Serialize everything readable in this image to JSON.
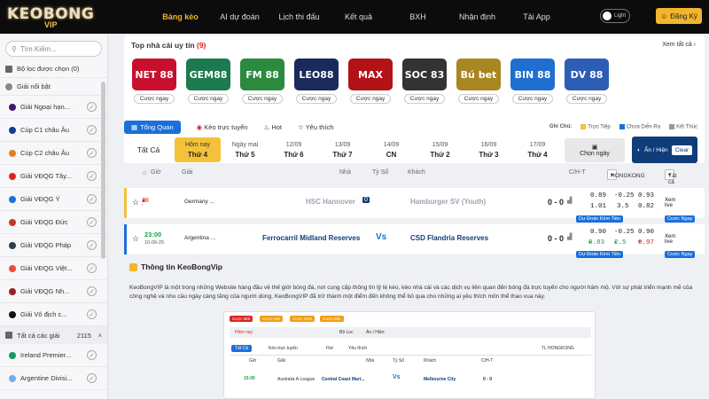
{
  "header": {
    "logo_top": "KEOBONG",
    "logo_bottom": "VIP",
    "nav": [
      "Bảng kèo",
      "AI dự đoán",
      "Lịch thi đấu",
      "Kết quả",
      "BXH",
      "Nhận định",
      "Tải App"
    ],
    "theme": "Light",
    "register": "Đăng Ký"
  },
  "sidebar": {
    "search_placeholder": "Tìm Kiếm...",
    "filter_label": "Bộ lọc được chọn (0)",
    "featured": "Giải nổi bật",
    "leagues": [
      "Giải Ngoại hạn...",
      "Cúp C1 châu Âu",
      "Cúp C2 châu Âu",
      "Giải VĐQG Tây...",
      "Giải VĐQG Ý",
      "Giải VĐQG Đức",
      "Giải VĐQG Pháp",
      "Giải VĐQG Việt...",
      "Giải VĐQG Nh...",
      "Giải Vô địch c..."
    ],
    "all_label": "Tất cả các giải",
    "all_count": "2115",
    "extra": [
      "Ireland Premier...",
      "Argentine Divisi..."
    ]
  },
  "top": {
    "title": "Top nhà cái uy tín",
    "count": "(9)",
    "see_all": "Xem tất cả",
    "bet": "Cược ngay",
    "books": [
      {
        "name": "NET 88",
        "bg": "#c8102e"
      },
      {
        "name": "GEM88",
        "bg": "#1c7a4e"
      },
      {
        "name": "FM 88",
        "bg": "#2b8a3e"
      },
      {
        "name": "LEO88",
        "bg": "#1a2a5a"
      },
      {
        "name": "MAX",
        "bg": "#b31217"
      },
      {
        "name": "SOC 83",
        "bg": "#333"
      },
      {
        "name": "Bú bet",
        "bg": "#a88620"
      },
      {
        "name": "BIN 88",
        "bg": "#1f6fd1"
      },
      {
        "name": "DV 88",
        "bg": "#2d5db5"
      }
    ]
  },
  "filters": {
    "overview": "Tổng Quan",
    "live": "Kèo trực tuyến",
    "hot": "Hot",
    "fav": "Yêu thích",
    "note": "Ghi Chú:",
    "legend": [
      "Trực Tiếp",
      "Chưa Diễn Ra",
      "Kết Thúc"
    ]
  },
  "days": [
    {
      "l1": "Tất Cả",
      "l2": ""
    },
    {
      "l1": "Hôm nay",
      "l2": "Thứ 4"
    },
    {
      "l1": "Ngày mai",
      "l2": "Thứ 5"
    },
    {
      "l1": "12/09",
      "l2": "Thứ 6"
    },
    {
      "l1": "13/09",
      "l2": "Thứ 7"
    },
    {
      "l1": "14/09",
      "l2": "CN"
    },
    {
      "l1": "15/09",
      "l2": "Thứ 2"
    },
    {
      "l1": "16/09",
      "l2": "Thứ 3"
    },
    {
      "l1": "17/09",
      "l2": "Thứ 4"
    }
  ],
  "choose_date": "Chọn ngày",
  "show_hide": "Ẩn / Hiện",
  "clear": "Clear",
  "table": {
    "time": "Giờ",
    "league": "Giải",
    "home": "Nhà",
    "score": "Tỷ Số",
    "away": "Khách",
    "ct": "C/H-T",
    "book": "HONGKONG",
    "all": "Tất cả"
  },
  "matches": [
    {
      "minute": "28 '",
      "league": "Germany ...",
      "home": "HSC Hannover",
      "score_a": "0",
      "score_b": "0",
      "away": "Hamburger SV (Youth)",
      "ht": "0 - 0",
      "o1": [
        "0.89",
        "-0.25",
        "0.93"
      ],
      "o2": [
        "1.01",
        "3.5",
        "0.82"
      ],
      "see": "Xem live",
      "tag1": "Dự Đoán Kèm Tiền",
      "tag2": "Cược Ngay"
    },
    {
      "time": "23:00",
      "date": "10-09-25",
      "league": "Argentina ...",
      "home": "Ferrocarril Midland Reserves",
      "vs": "Vs",
      "away": "CSD Flandria Reserves",
      "ht": "0 - 0",
      "o1": [
        "0.90",
        "-0.25",
        "0.90"
      ],
      "o2": [
        "0.83",
        "2.5",
        "0.97"
      ],
      "see": "Xem live",
      "tag1": "Dự Đoán Kèm Tiền",
      "tag2": "Cược Ngay"
    }
  ],
  "info": {
    "title": "Thông tin KeoBongVip",
    "text": "KeoBongVIP là một trong những Website hàng đầu về thế giới bóng đá, nơi cung cấp thông tin tỷ lệ kèo, kèo nhà cái và các dịch vụ liên quan đến bóng đá trực tuyến cho người hâm mộ. Với sự phát triển mạnh mẽ của công nghệ và nhu cầu ngày càng tăng của người dùng, KeoBongVIP đã trở thành một điểm đến không thể bỏ qua cho những ai yêu thích môn thể thao vua này."
  },
  "shot": {
    "pills": [
      "Cược Mới",
      "Cược Hot",
      "Cược Sớm",
      "Cược Đặc"
    ],
    "today": "Hôm nay",
    "filter": "Bộ Lọc",
    "showhide": "Ẩn / Hiện",
    "overview": "Tất Cả",
    "live": "Kèo trực tuyến",
    "hot": "Hot",
    "fav": "Yêu thích",
    "book": "TL HONGKONG",
    "time": "15:00",
    "league": "Australia A-League",
    "home": "Central Coast Mari...",
    "vs": "Vs",
    "away": "Melbourne City",
    "score": "0 - 0"
  }
}
